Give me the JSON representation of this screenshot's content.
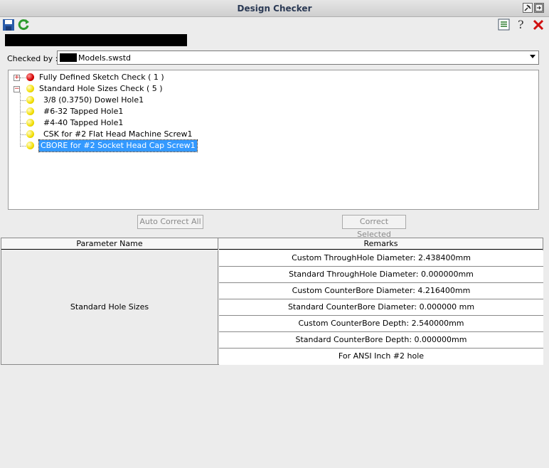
{
  "window": {
    "title": "Design Checker"
  },
  "toolbar": {
    "save_icon": "save-icon",
    "refresh_icon": "refresh-icon",
    "list_icon": "list-icon",
    "help_icon": "help-icon",
    "close_icon": "close-icon"
  },
  "checked_by": {
    "label": "Checked by :",
    "value": "Models.swstd"
  },
  "tree": {
    "groups": [
      {
        "label": "Fully Defined Sketch Check ( 1 )",
        "status": "red",
        "expanded": false
      },
      {
        "label": "Standard Hole Sizes Check ( 5 )",
        "status": "yellow",
        "expanded": true
      }
    ],
    "children": [
      "3/8 (0.3750) Dowel Hole1",
      "#6-32 Tapped Hole1",
      "#4-40 Tapped Hole1",
      "CSK for #2 Flat Head Machine Screw1",
      "CBORE for #2 Socket Head Cap Screw1"
    ],
    "selected_child": "CBORE for #2 Socket Head Cap Screw1"
  },
  "buttons": {
    "auto_correct_all": "Auto Correct All",
    "correct_selected": "Correct Selected"
  },
  "grid": {
    "headers": [
      "Parameter Name",
      "Remarks"
    ],
    "parameter": "Standard Hole Sizes",
    "remarks": [
      "Custom ThroughHole Diameter: 2.438400mm",
      "Standard ThroughHole Diameter: 0.000000mm",
      "Custom CounterBore Diameter: 4.216400mm",
      "Standard CounterBore Diameter: 0.000000 mm",
      "Custom CounterBore Depth: 2.540000mm",
      "Standard CounterBore Depth: 0.000000mm",
      "For ANSI Inch #2 hole"
    ]
  }
}
